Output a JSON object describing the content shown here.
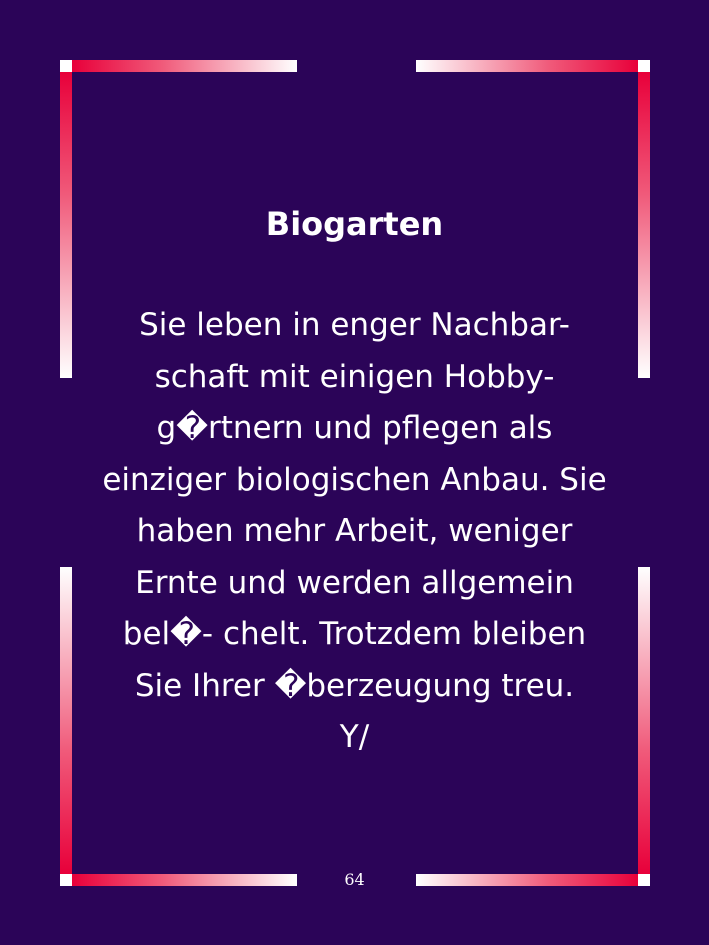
{
  "card": {
    "title": "Biogarten",
    "body_lines": [
      "Sie leben in enger Nachbar-",
      "schaft mit einigen Hobby-",
      "g�rtnern und pflegen als",
      "einziger biologischen Anbau. Sie",
      "haben mehr Arbeit, weniger",
      "Ernte und werden allgemein",
      "bel�- chelt. Trotzdem bleiben",
      "Sie Ihrer �berzeugung treu.",
      "Y/"
    ],
    "page_number": "64"
  },
  "colors": {
    "background": "#2b0458",
    "frame_accent": "#e8003a",
    "frame_light": "#ffffff",
    "text": "#ffffff"
  }
}
